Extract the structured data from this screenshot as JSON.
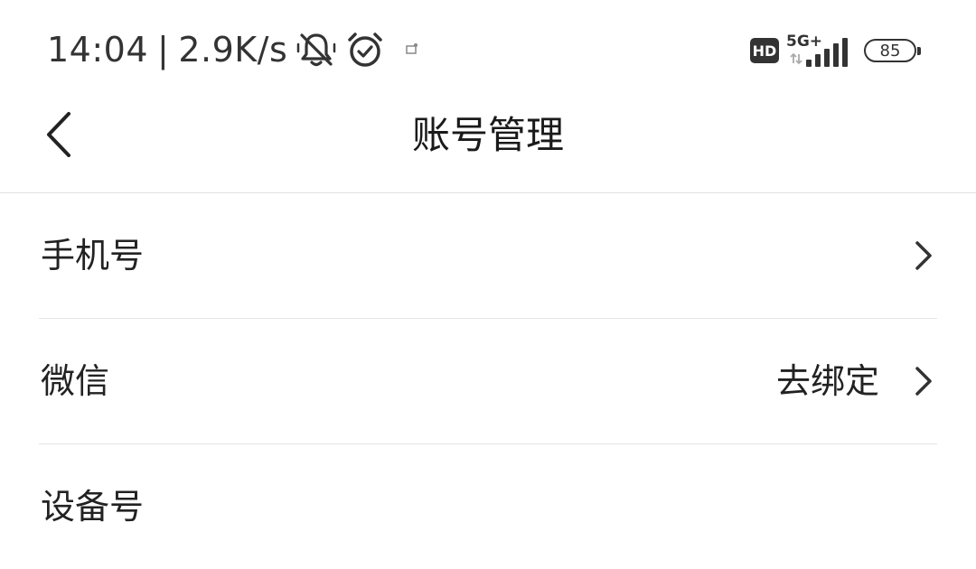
{
  "status_bar": {
    "time": "14:04",
    "separator": "|",
    "net_speed": "2.9K/s",
    "icons": [
      "bell-muted-icon",
      "alarm-clock-icon",
      "notification-dot-icon"
    ],
    "hd_label": "HD",
    "network_label": "5G+",
    "battery_level": "85"
  },
  "nav": {
    "back_icon": "chevron-left-icon",
    "title": "账号管理"
  },
  "items": [
    {
      "label": "手机号",
      "value": "",
      "chevron": true
    },
    {
      "label": "微信",
      "value": "去绑定",
      "chevron": true
    },
    {
      "label": "设备号",
      "value": "",
      "chevron": false
    }
  ],
  "colors": {
    "text": "#222222",
    "divider": "#e4e4e4",
    "background": "#ffffff"
  }
}
